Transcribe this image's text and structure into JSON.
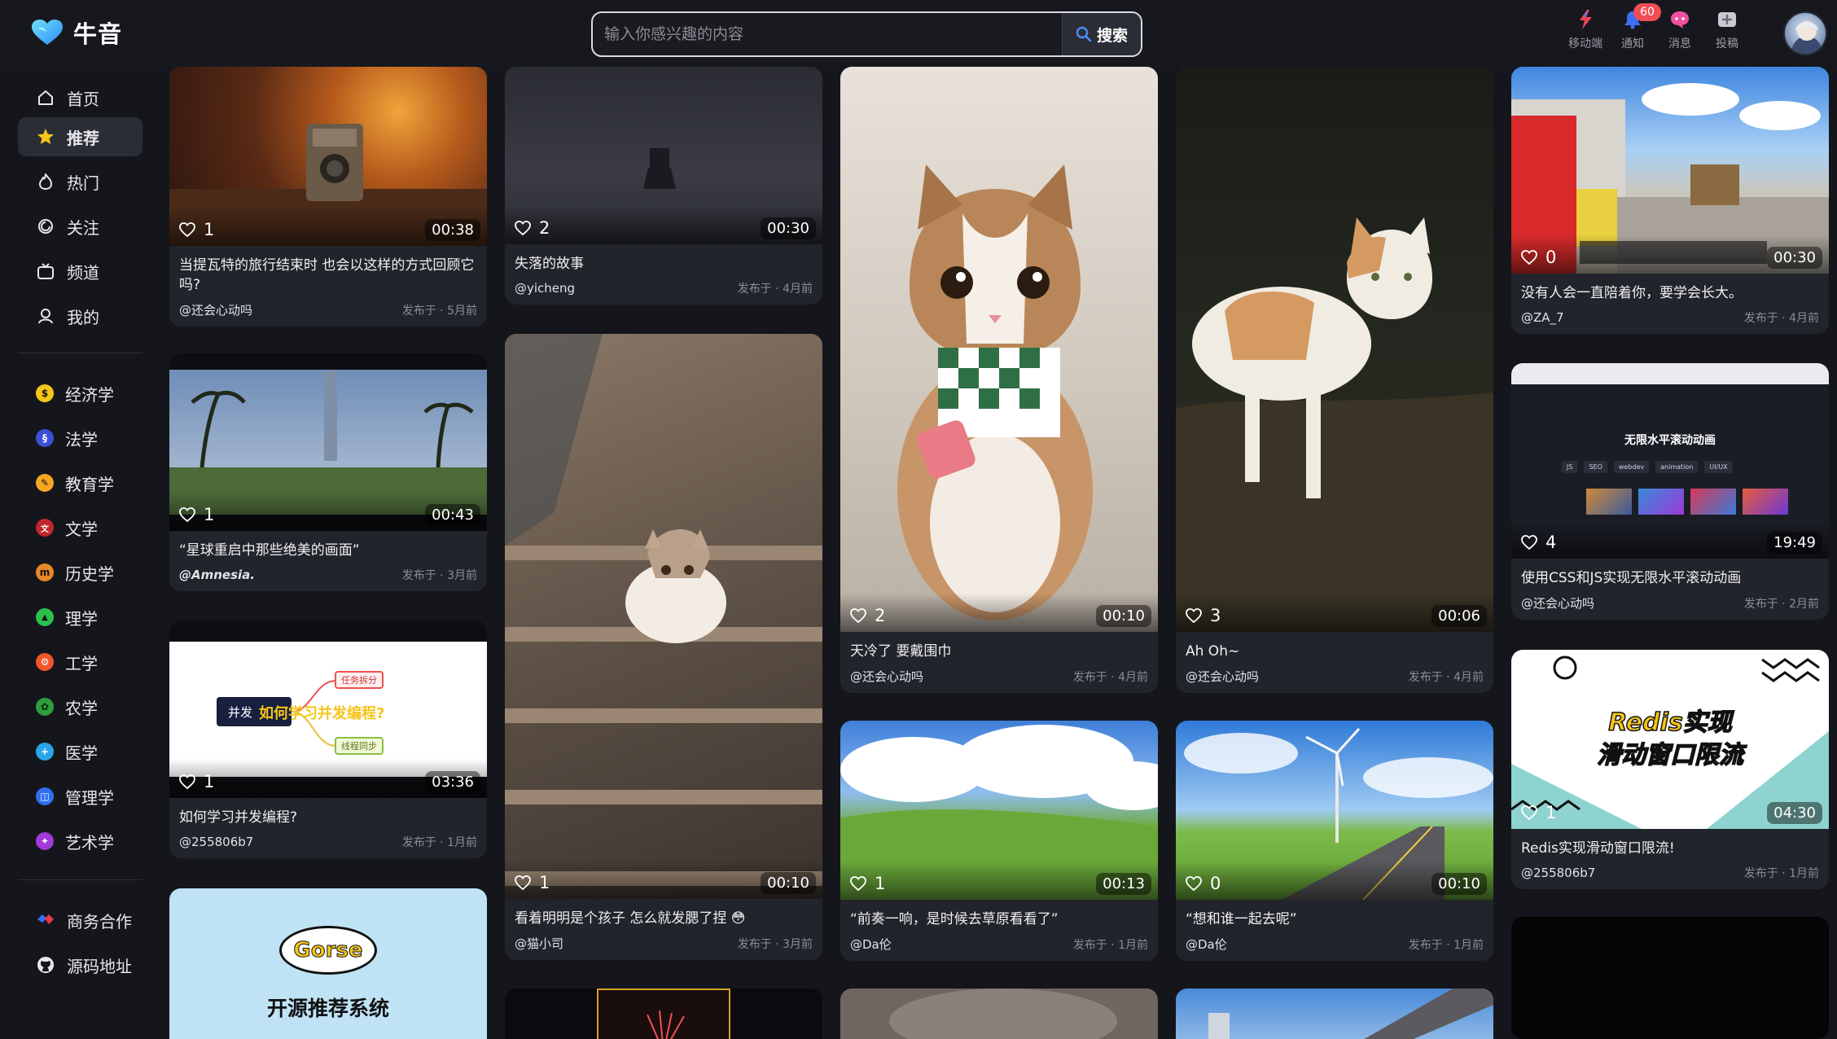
{
  "app": {
    "name": "牛音"
  },
  "search": {
    "placeholder": "输入你感兴趣的内容",
    "button": "搜索"
  },
  "header_actions": [
    {
      "label": "移动端",
      "icon": "mobile-icon"
    },
    {
      "label": "通知",
      "icon": "bell-icon",
      "badge": "60"
    },
    {
      "label": "消息",
      "icon": "message-icon"
    },
    {
      "label": "投稿",
      "icon": "upload-icon"
    }
  ],
  "sidebar": {
    "main": [
      {
        "label": "首页",
        "icon": "home-icon"
      },
      {
        "label": "推荐",
        "icon": "star-icon",
        "active": true
      },
      {
        "label": "热门",
        "icon": "fire-icon"
      },
      {
        "label": "关注",
        "icon": "follow-icon"
      },
      {
        "label": "频道",
        "icon": "channel-icon"
      },
      {
        "label": "我的",
        "icon": "user-icon"
      }
    ],
    "categories": [
      {
        "label": "经济学",
        "color": "#f5c518",
        "glyph": "$"
      },
      {
        "label": "法学",
        "color": "#3b4fd8",
        "glyph": "§"
      },
      {
        "label": "教育学",
        "color": "#f5a623",
        "glyph": "✎"
      },
      {
        "label": "文学",
        "color": "#c0262d",
        "glyph": "文"
      },
      {
        "label": "历史学",
        "color": "#e8862a",
        "glyph": "m"
      },
      {
        "label": "理学",
        "color": "#2bc04a",
        "glyph": "▲"
      },
      {
        "label": "工学",
        "color": "#f0562a",
        "glyph": "⚙"
      },
      {
        "label": "农学",
        "color": "#2e9e3f",
        "glyph": "✿"
      },
      {
        "label": "医学",
        "color": "#2aa6e8",
        "glyph": "+"
      },
      {
        "label": "管理学",
        "color": "#2f6ff0",
        "glyph": "◫"
      },
      {
        "label": "艺术学",
        "color": "#a13ad8",
        "glyph": "✦"
      }
    ],
    "footer": [
      {
        "label": "商务合作",
        "icon": "cooperation-icon"
      },
      {
        "label": "源码地址",
        "icon": "github-icon"
      }
    ]
  },
  "cards": [
    {
      "title": "当提瓦特的旅行结束时 也会以这样的方式回顾它吗?",
      "author": "@还会心动吗",
      "date": "发布于 · 5月前",
      "likes": "1",
      "duration": "00:38"
    },
    {
      "title": "“星球重启中那些绝美的画面”",
      "author": "@Amnesia.",
      "date": "发布于 · 3月前",
      "likes": "1",
      "duration": "00:43"
    },
    {
      "title": "如何学习并发编程?",
      "author": "@255806b7",
      "date": "发布于 · 1月前",
      "likes": "1",
      "duration": "03:36",
      "overlay": {
        "left": "并发",
        "center": "如何学习并发编程?",
        "top": "任务拆分",
        "bottom": "线程同步"
      }
    },
    {
      "title": "",
      "author": "",
      "date": "",
      "likes": "",
      "duration": "",
      "overlay": {
        "badge": "Gorse",
        "caption": "开源推荐系统"
      }
    },
    {
      "title": "失落的故事",
      "author": "@yicheng",
      "date": "发布于 · 4月前",
      "likes": "2",
      "duration": "00:30"
    },
    {
      "title": "看着明明是个孩子 怎么就发腮了捏 😳",
      "author": "@猫小司",
      "date": "发布于 · 3月前",
      "likes": "1",
      "duration": "00:10"
    },
    {
      "title": "天冷了 要戴围巾",
      "author": "@还会心动吗",
      "date": "发布于 · 4月前",
      "likes": "2",
      "duration": "00:10"
    },
    {
      "title": "“前奏一响，是时候去草原看看了”",
      "author": "@Da伦",
      "date": "发布于 · 1月前",
      "likes": "1",
      "duration": "00:13"
    },
    {
      "title": "Ah Oh~",
      "author": "@还会心动吗",
      "date": "发布于 · 4月前",
      "likes": "3",
      "duration": "00:06"
    },
    {
      "title": "“想和谁一起去呢”",
      "author": "@Da伦",
      "date": "发布于 · 1月前",
      "likes": "0",
      "duration": "00:10"
    },
    {
      "title": "没有人会一直陪着你，要学会长大。",
      "author": "@ZA_7",
      "date": "发布于 · 4月前",
      "likes": "0",
      "duration": "00:30"
    },
    {
      "title": "使用CSS和JS实现无限水平滚动动画",
      "author": "@还会心动吗",
      "date": "发布于 · 2月前",
      "likes": "4",
      "duration": "19:49",
      "overlay": {
        "heading": "无限水平滚动动画",
        "tags": [
          "JS",
          "SEO",
          "webdev",
          "animation",
          "UI/UX"
        ]
      }
    },
    {
      "title": "Redis实现滑动窗口限流!",
      "author": "@255806b7",
      "date": "发布于 · 1月前",
      "likes": "1",
      "duration": "04:30",
      "overlay": {
        "line1": "Redis实现",
        "line2": "滑动窗口限流"
      }
    }
  ]
}
